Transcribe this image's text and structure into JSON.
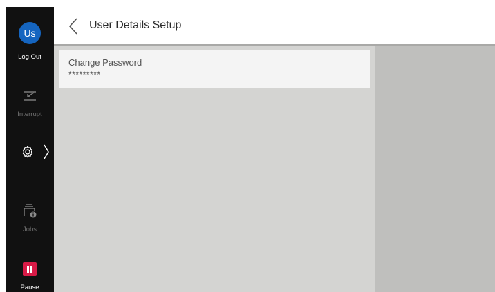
{
  "sidebar": {
    "user_initials": "Us",
    "logout_label": "Log Out",
    "interrupt_label": "Interrupt",
    "jobs_label": "Jobs",
    "pause_label": "Pause"
  },
  "header": {
    "title": "User Details Setup"
  },
  "main": {
    "items": [
      {
        "label": "Change Password",
        "value": "*********"
      }
    ]
  },
  "colors": {
    "avatar": "#1565c0",
    "pause": "#d81b47",
    "sidebar": "#111111"
  }
}
